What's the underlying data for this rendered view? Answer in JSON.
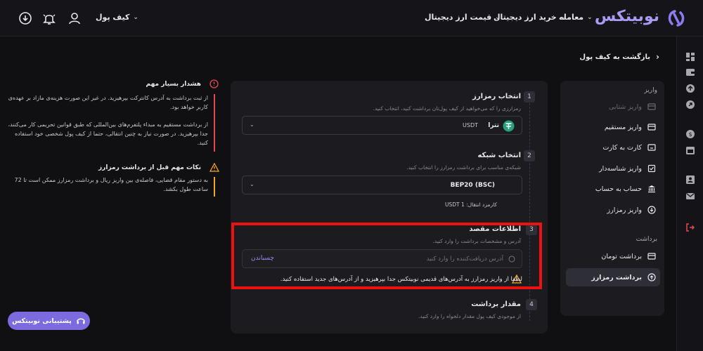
{
  "header": {
    "logo": "نوبیتکس",
    "nav": [
      {
        "label": "معامله"
      },
      {
        "label": "خرید ارز دیجیتال"
      },
      {
        "label": "قیمت ارز دیجیتال"
      }
    ],
    "wallet_label": "کیف پول"
  },
  "back_label": "بازگشت به کیف پول",
  "sidebar": {
    "deposit_heading": "واریز",
    "deposit_items": [
      {
        "label": "واریز شتابی",
        "disabled": true
      },
      {
        "label": "واریز مستقیم"
      },
      {
        "label": "کارت به کارت"
      },
      {
        "label": "واریز شناسه‌دار"
      },
      {
        "label": "حساب به حساب"
      },
      {
        "label": "واریز رمزارز"
      }
    ],
    "withdraw_heading": "برداشت",
    "withdraw_items": [
      {
        "label": "برداشت تومان"
      },
      {
        "label": "برداشت رمزارز",
        "active": true
      }
    ]
  },
  "form": {
    "step1": {
      "num": "1",
      "title": "انتخاب رمزارز",
      "desc": "رمزارزی را که می‌خواهید از کیف پول‌تان برداشت کنید، انتخاب کنید.",
      "selected_name": "تترا",
      "selected_code": "USDT"
    },
    "step2": {
      "num": "2",
      "title": "انتخاب شبکه",
      "desc": "شبکه‌ی مناسب برای برداشت رمزارز را انتخاب کنید.",
      "selected": "BEP20 (BSC)",
      "fee": "کارمزد انتقال: USDT 1"
    },
    "step3": {
      "num": "3",
      "title": "اطلاعات مقصد",
      "desc": "آدرس و مشخصات برداشت را وارد کنید.",
      "placeholder": "آدرس دریافت‌کننده را وارد کنید",
      "paste": "چسباندن",
      "warning": "لطفا از واریز رمزارز به آدرس‌های قدیمی نوبیتکس جدا بپرهیزید و از آدرس‌های جدید استفاده کنید."
    },
    "step4": {
      "num": "4",
      "title": "مقدار برداشت",
      "desc": "از موجودی کیف پول مقدار دلخواه را وارد کنید."
    }
  },
  "warnings": [
    {
      "title": "هشدار بسیار مهم",
      "color": "#e5484d",
      "body1": "از ثبت برداشت به آدرس کانترکت بپرهیزید. در غیر این صورت هزینه‌ی مازاد بر عهده‌ی کاربر خواهد بود.",
      "body2": "از برداشت مستقیم به مبداء پلتفرم‌های بین‌المللی که طبق قوانین تحریمی کار می‌کنند، جدا بپرهیزید. در صورت نیاز به چنین انتقالی، حتما از کیف پول شخصی خود استفاده کنید."
    },
    {
      "title": "نکات مهم قبل از برداشت رمزارز",
      "color": "#f5a524",
      "body1": "به دستور مقام قضایی، فاصله‌ی بین واریز ریال و برداشت رمزارز ممکن است تا 72 ساعت طول بکشد."
    }
  ],
  "support_label": "پشتیبانی نوبیتکس",
  "colors": {
    "accent": "#7c6bde",
    "highlight": "#ee1111",
    "tether": "#26a17b"
  }
}
